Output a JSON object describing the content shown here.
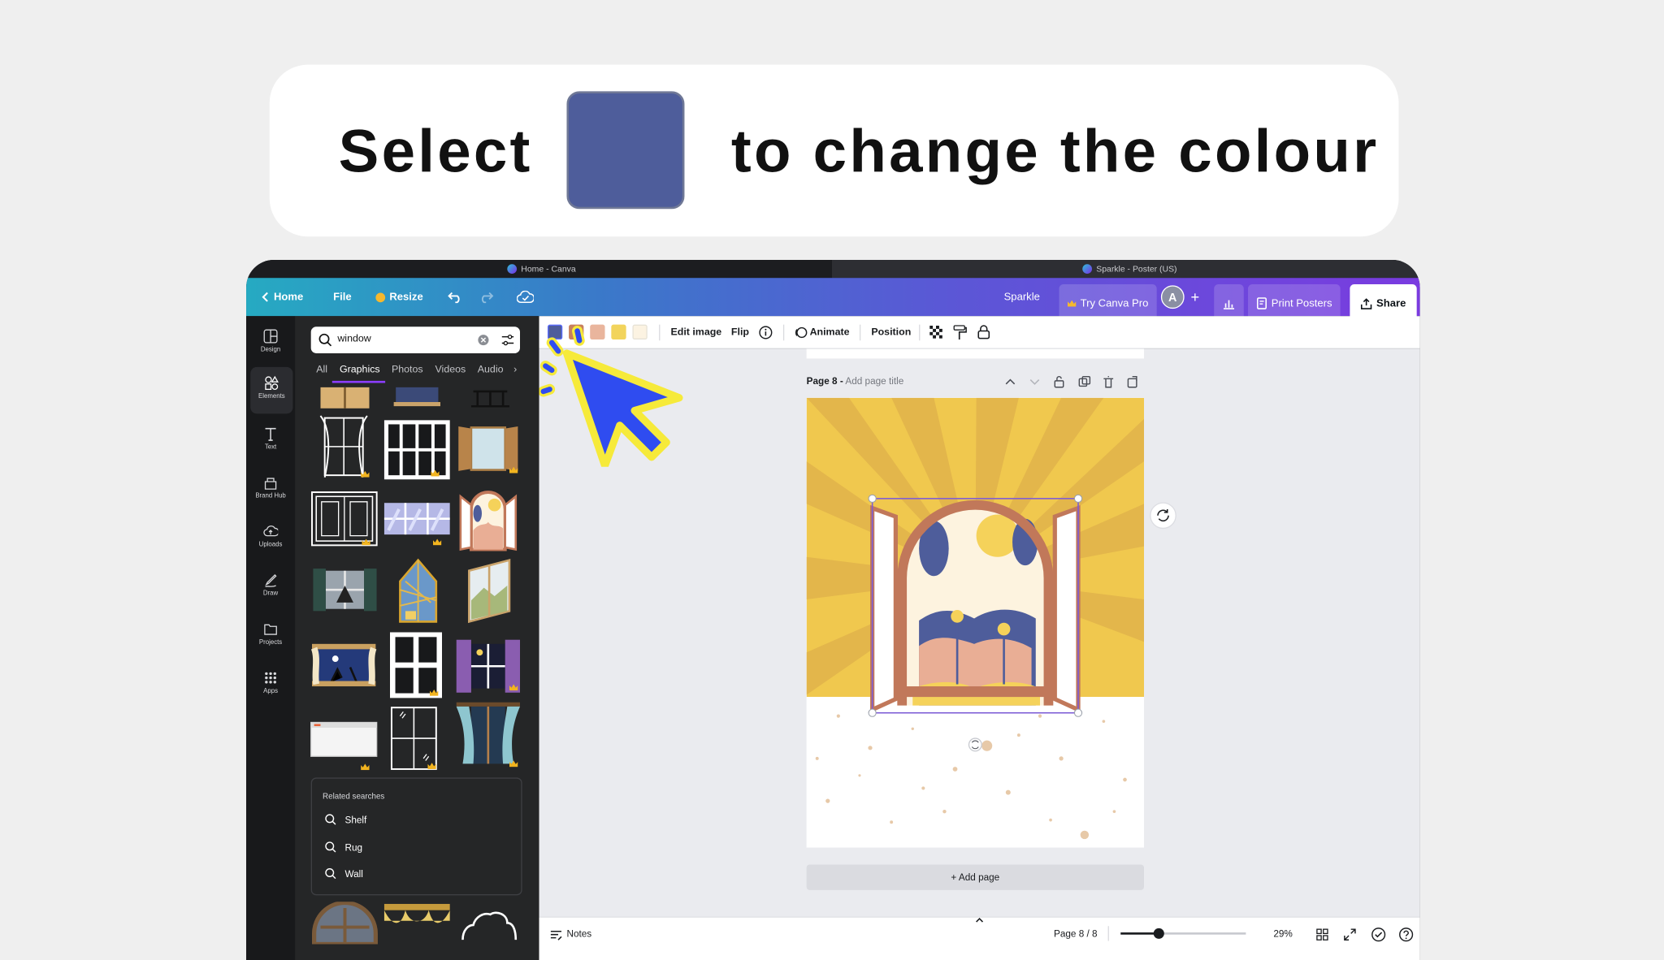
{
  "instruction": {
    "part1": "Select",
    "part2": "to change the colour",
    "swatch_color": "#4e5d9b"
  },
  "browser": {
    "tab1": "Home - Canva",
    "tab2": "Sparkle - Poster (US)"
  },
  "topbar": {
    "home": "Home",
    "file": "File",
    "resize": "Resize",
    "title": "Sparkle",
    "try_pro": "Try Canva Pro",
    "avatar": "A",
    "print": "Print Posters",
    "share": "Share"
  },
  "rail": [
    {
      "label": "Design",
      "icon": "layout-icon"
    },
    {
      "label": "Elements",
      "icon": "shapes-icon"
    },
    {
      "label": "Text",
      "icon": "text-icon"
    },
    {
      "label": "Brand Hub",
      "icon": "brand-icon"
    },
    {
      "label": "Uploads",
      "icon": "upload-icon"
    },
    {
      "label": "Draw",
      "icon": "draw-icon"
    },
    {
      "label": "Projects",
      "icon": "folder-icon"
    },
    {
      "label": "Apps",
      "icon": "apps-icon"
    }
  ],
  "panel": {
    "search_value": "window",
    "tabs": [
      "All",
      "Graphics",
      "Photos",
      "Videos",
      "Audio"
    ],
    "active_tab": "Graphics",
    "related_title": "Related searches",
    "related": [
      "Shelf",
      "Rug",
      "Wall"
    ]
  },
  "context": {
    "swatches": [
      "#4e5d9b",
      "#c8805d",
      "#e9b59d",
      "#f2d45c",
      "#fcf3e2"
    ],
    "edit_image": "Edit image",
    "flip": "Flip",
    "animate": "Animate",
    "position": "Position"
  },
  "canvas": {
    "page_label": "Page 8 -",
    "page_title_placeholder": "Add page title",
    "add_page": "+ Add page"
  },
  "bottom": {
    "notes": "Notes",
    "page_count": "Page 8 / 8",
    "zoom": "29%",
    "zoom_fraction": 0.29
  }
}
